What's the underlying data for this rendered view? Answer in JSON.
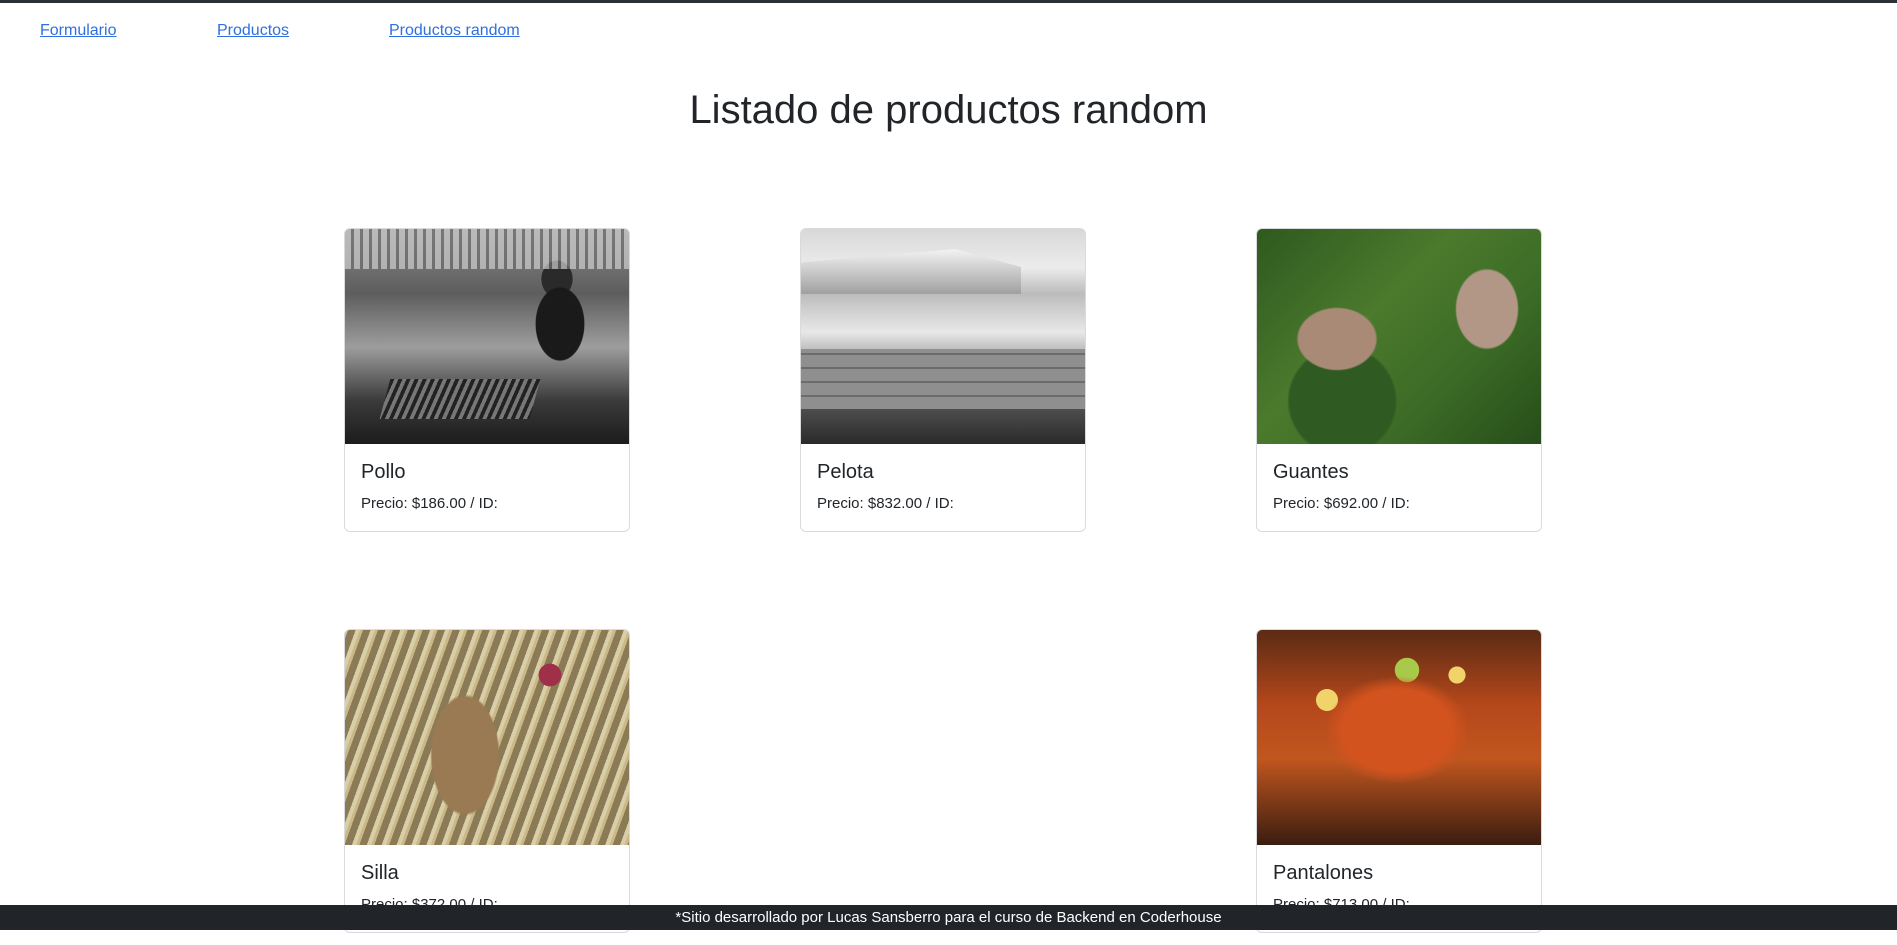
{
  "nav": {
    "links": [
      {
        "label": "Formulario"
      },
      {
        "label": "Productos"
      },
      {
        "label": "Productos random"
      }
    ]
  },
  "page": {
    "title": "Listado de productos random"
  },
  "products": [
    {
      "name": "Pollo",
      "price_text": "Precio: $186.00 / ID:",
      "image_icon": "chef-photo"
    },
    {
      "name": "Pelota",
      "price_text": "Precio: $832.00 / ID:",
      "image_icon": "harbor-photo"
    },
    {
      "name": "Guantes",
      "price_text": "Precio: $692.00 / ID:",
      "image_icon": "mushroom-photo"
    },
    {
      "name": "Silla",
      "price_text": "Precio: $372.00 / ID:",
      "image_icon": "squirrel-photo"
    },
    {
      "name": "Pantalones",
      "price_text": "Precio: $713.00 / ID:",
      "image_icon": "crayfish-photo"
    }
  ],
  "footer": {
    "text": "*Sitio desarrollado por Lucas Sansberro para el curso de Backend en Coderhouse"
  },
  "colors": {
    "link": "#2f6fe0",
    "footer_bg": "#212529",
    "text": "#212529"
  }
}
